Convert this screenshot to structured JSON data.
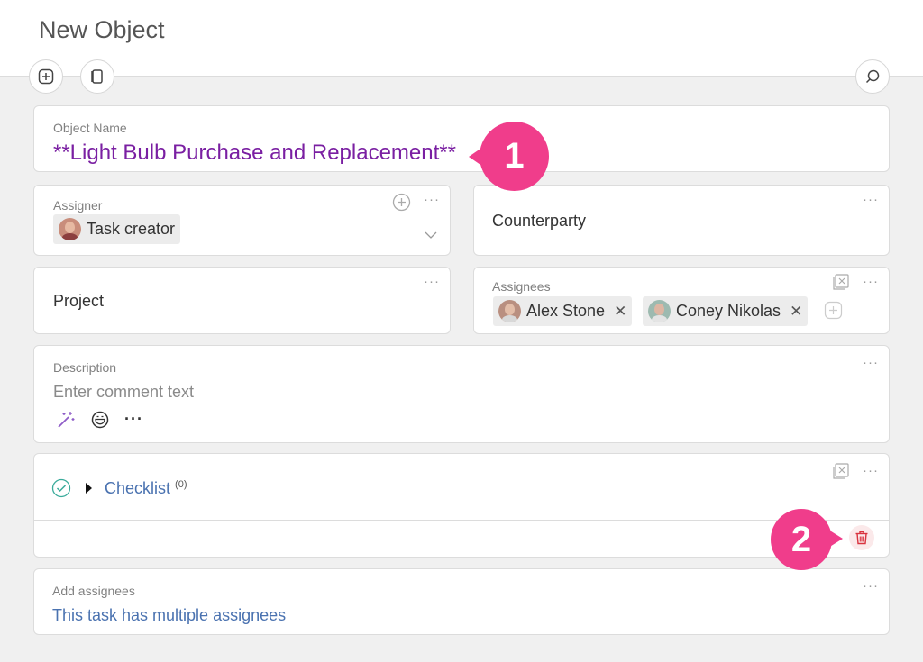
{
  "header": {
    "title": "New Object"
  },
  "object_name": {
    "label": "Object Name",
    "value": "**Light Bulb Purchase and Replacement**"
  },
  "assigner": {
    "label": "Assigner",
    "value": "Task creator"
  },
  "counterparty": {
    "label": "Counterparty"
  },
  "project": {
    "label": "Project"
  },
  "assignees": {
    "label": "Assignees",
    "people": [
      "Alex Stone",
      "Coney Nikolas"
    ]
  },
  "description": {
    "label": "Description",
    "placeholder": "Enter comment text"
  },
  "checklist": {
    "label": "Checklist",
    "count": "(0)"
  },
  "add_assignees": {
    "label": "Add assignees",
    "value": "This task has multiple assignees"
  },
  "badges": [
    "1",
    "2"
  ],
  "colors": {
    "accent_purple": "#7a1fa2",
    "link_blue": "#4a72b0",
    "badge_pink": "#f03d8b",
    "delete_red": "#d9333f",
    "check_teal": "#3aab9b"
  },
  "icons": [
    "add-object-icon",
    "panel-icon",
    "search-icon",
    "plus-circle-icon",
    "chevron-down-icon",
    "clear-icon",
    "magic-wand-icon",
    "emoji-icon",
    "more-icon",
    "check-circle-icon",
    "caret-right-icon",
    "trash-icon"
  ]
}
